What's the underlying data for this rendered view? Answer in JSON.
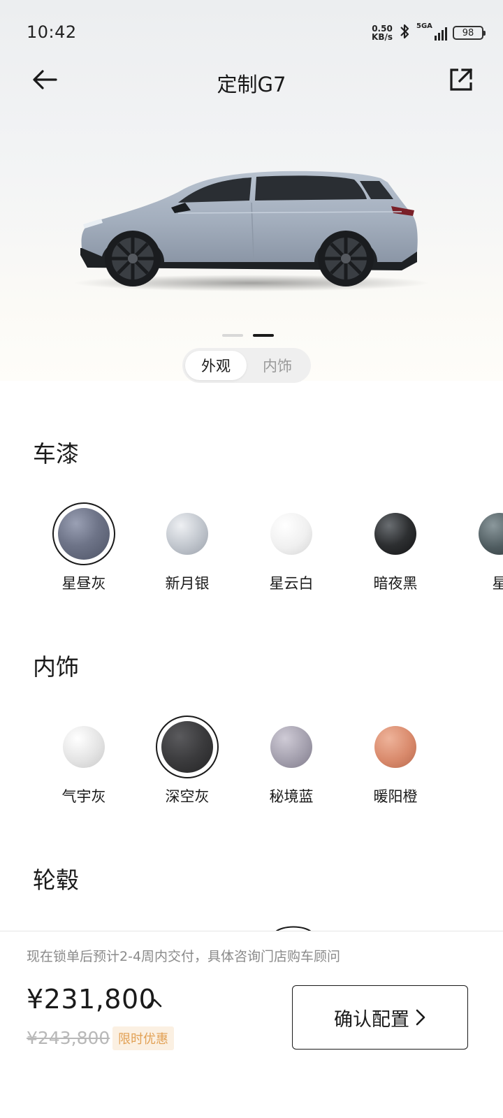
{
  "status_bar": {
    "time": "10:42",
    "net_speed_value": "0.50",
    "net_speed_unit": "KB/s",
    "network": "5GA",
    "battery": "98",
    "icons": [
      "bluetooth-icon",
      "signal-icon",
      "battery-icon"
    ]
  },
  "nav": {
    "title": "定制G7",
    "back_icon": "arrow-left-icon",
    "share_icon": "share-external-icon"
  },
  "hero": {
    "car_color": "#a9b4c2",
    "pager": {
      "count": 2,
      "active_index": 1
    },
    "view_tabs": [
      {
        "label": "外观",
        "active": true
      },
      {
        "label": "内饰",
        "active": false
      }
    ]
  },
  "sections": {
    "paint": {
      "title": "车漆",
      "options": [
        {
          "label": "星昼灰",
          "color": "#6e7488",
          "selected": true
        },
        {
          "label": "新月银",
          "color": "#c4c9d0",
          "selected": false
        },
        {
          "label": "星云白",
          "color": "#f0f0f0",
          "selected": false
        },
        {
          "label": "暗夜黑",
          "color": "#2d2f31",
          "selected": false
        },
        {
          "label": "星",
          "color": "#4f5c60",
          "selected": false
        }
      ]
    },
    "interior": {
      "title": "内饰",
      "options": [
        {
          "label": "气宇灰",
          "color": "#e4e4e4",
          "selected": false
        },
        {
          "label": "深空灰",
          "color": "#3b3b3d",
          "selected": true
        },
        {
          "label": "秘境蓝",
          "color": "#a4a0ae",
          "selected": false
        },
        {
          "label": "暖阳橙",
          "color": "#d98a6c",
          "selected": false
        }
      ]
    },
    "wheels": {
      "title": "轮毂"
    }
  },
  "bottom": {
    "delivery_note": "现在锁单后预计2-4周内交付，具体咨询门店购车顾问",
    "price": "¥231,800",
    "original_price": "¥243,800",
    "promo_badge": "限时优惠",
    "confirm_label": "确认配置",
    "caret_icon": "chevron-up-icon",
    "confirm_icon": "chevron-right-icon"
  }
}
